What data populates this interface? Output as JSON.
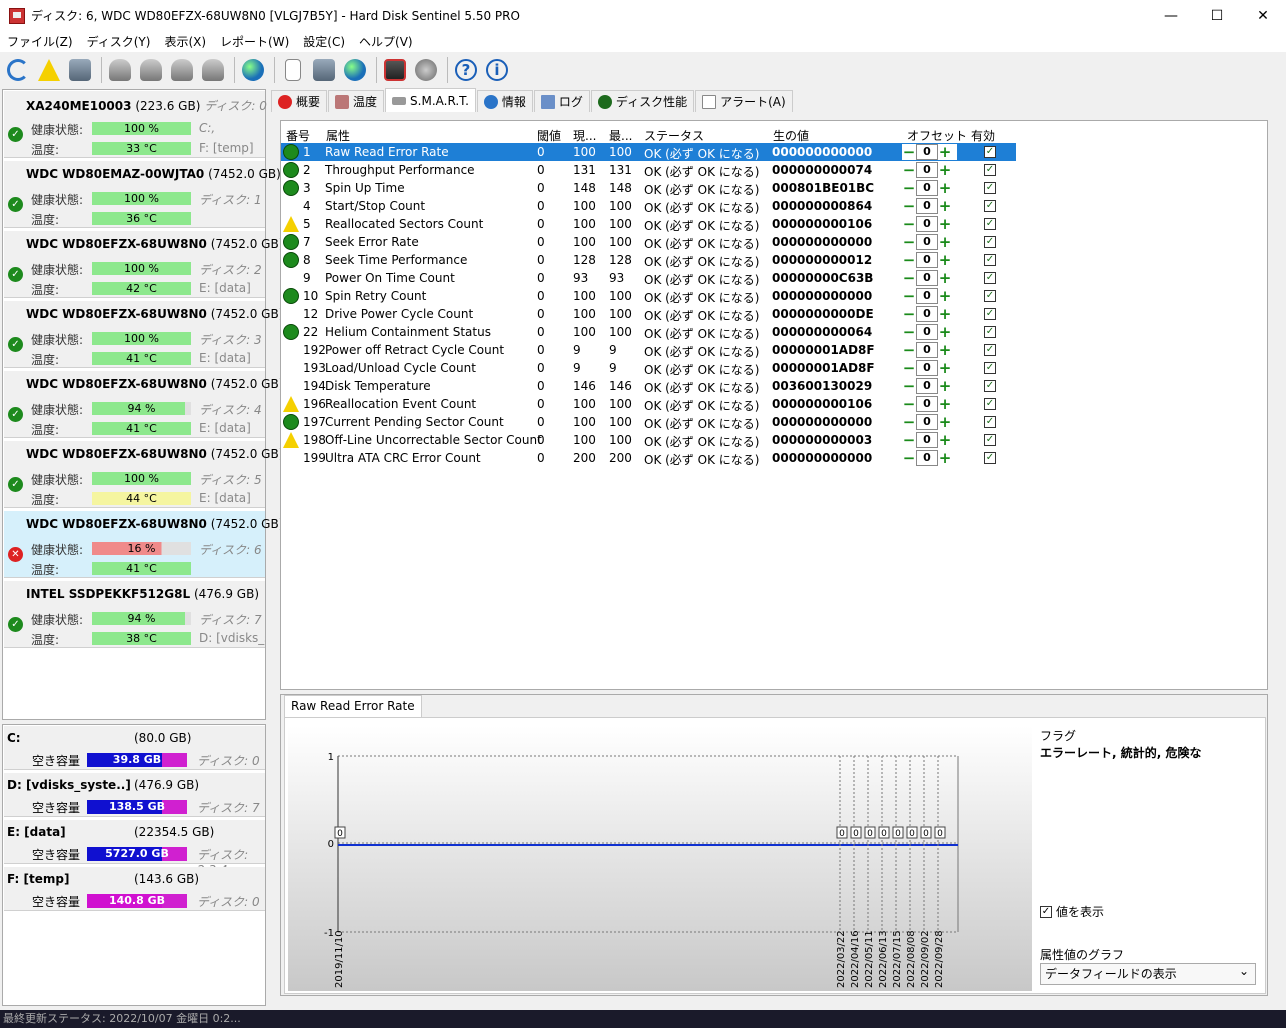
{
  "window": {
    "title": "ディスク: 6, WDC WD80EFZX-68UW8N0 [VLGJ7B5Y]  -  Hard Disk Sentinel 5.50 PRO",
    "min": "—",
    "max": "☐",
    "close": "✕"
  },
  "menu": [
    "ファイル(Z)",
    "ディスク(Y)",
    "表示(X)",
    "レポート(W)",
    "設定(C)",
    "ヘルプ(V)"
  ],
  "toolbar_icons": [
    "refresh-icon",
    "alert-icon",
    "disk-info-icon",
    "drive-icon",
    "drive-icon",
    "drive-icon",
    "drive-icon",
    "globe-icon",
    "document-icon",
    "sync-icon",
    "network-icon",
    "monitor-icon",
    "speaker-icon",
    "help-icon",
    "info-icon"
  ],
  "disks": [
    {
      "model": "XA240ME10003",
      "size": "(223.6 GB)",
      "disk": "ディスク: 0",
      "health": "100 %",
      "temp": "33 °C",
      "health_drv": "C:,",
      "temp_drv": "F: [temp]",
      "health_pct": 100,
      "status": "ok",
      "temp_color": "#8de88d"
    },
    {
      "model": "WDC WD80EMAZ-00WJTA0",
      "size": "(7452.0 GB)",
      "disk": "",
      "health": "100 %",
      "temp": "36 °C",
      "health_drv": "ディスク: 1",
      "temp_drv": "",
      "health_pct": 100,
      "status": "ok",
      "temp_color": "#8de88d"
    },
    {
      "model": "WDC WD80EFZX-68UW8N0",
      "size": "(7452.0 GB)",
      "disk": "",
      "health": "100 %",
      "temp": "42 °C",
      "health_drv": "ディスク: 2",
      "temp_drv": "E: [data]",
      "health_pct": 100,
      "status": "ok",
      "temp_color": "#8de88d"
    },
    {
      "model": "WDC WD80EFZX-68UW8N0",
      "size": "(7452.0 GB)",
      "disk": "",
      "health": "100 %",
      "temp": "41 °C",
      "health_drv": "ディスク: 3",
      "temp_drv": "E: [data]",
      "health_pct": 100,
      "status": "ok",
      "temp_color": "#8de88d"
    },
    {
      "model": "WDC WD80EFZX-68UW8N0",
      "size": "(7452.0 GB)",
      "disk": "",
      "health": "94 %",
      "temp": "41 °C",
      "health_drv": "ディスク: 4",
      "temp_drv": "E: [data]",
      "health_pct": 94,
      "status": "ok",
      "temp_color": "#8de88d"
    },
    {
      "model": "WDC WD80EFZX-68UW8N0",
      "size": "(7452.0 GB)",
      "disk": "",
      "health": "100 %",
      "temp": "44 °C",
      "health_drv": "ディスク: 5",
      "temp_drv": "E: [data]",
      "health_pct": 100,
      "status": "ok",
      "temp_color": "#f5f5a0"
    },
    {
      "model": "WDC WD80EFZX-68UW8N0",
      "size": "(7452.0 GB)",
      "disk": "",
      "health": "16 %",
      "temp": "41 °C",
      "health_drv": "ディスク: 6",
      "temp_drv": "",
      "health_pct": 16,
      "status": "bad",
      "temp_color": "#8de88d"
    },
    {
      "model": "INTEL SSDPEKKF512G8L",
      "size": "(476.9 GB)",
      "disk": "",
      "health": "94 %",
      "temp": "38 °C",
      "health_drv": "ディスク: 7",
      "temp_drv": "D: [vdisks_sy",
      "health_pct": 94,
      "status": "ok",
      "temp_color": "#8de88d"
    }
  ],
  "labels": {
    "health": "健康状態:",
    "temp": "温度:",
    "free": "空き容量"
  },
  "partitions": [
    {
      "name": "C:",
      "size": "(80.0 GB)",
      "free": "39.8 GB",
      "disk": "ディスク: 0",
      "color": "#1010d0"
    },
    {
      "name": "D: [vdisks_syste..]",
      "size": "(476.9 GB)",
      "free": "138.5 GB",
      "disk": "ディスク: 7",
      "color": "#1010d0"
    },
    {
      "name": "E: [data]",
      "size": "(22354.5 GB)",
      "free": "5727.0 GB",
      "disk": "ディスク: 2,3,4",
      "color": "#1010d0"
    },
    {
      "name": "F: [temp]",
      "size": "(143.6 GB)",
      "free": "140.8 GB",
      "disk": "ディスク: 0",
      "color": "#d010d0"
    }
  ],
  "tabs": [
    {
      "label": "概要",
      "icon": "error-icon"
    },
    {
      "label": "温度",
      "icon": "thermometer-icon"
    },
    {
      "label": "S.M.A.R.T.",
      "icon": "smart-icon"
    },
    {
      "label": "情報",
      "icon": "info-icon"
    },
    {
      "label": "ログ",
      "icon": "log-icon"
    },
    {
      "label": "ディスク性能",
      "icon": "performance-icon"
    },
    {
      "label": "アラート(A)",
      "icon": "alert-icon"
    }
  ],
  "smart": {
    "headers": {
      "id": "番号",
      "attr": "属性",
      "thr": "閾値",
      "cur": "現...",
      "worst": "最...",
      "status": "ステータス",
      "raw": "生の値",
      "offset": "オフセット",
      "enabled": "有効"
    },
    "rows": [
      {
        "id": "1",
        "attr": "Raw Read Error Rate",
        "thr": "0",
        "cur": "100",
        "worst": "100",
        "status": "OK (必ず OK になる)",
        "raw": "000000000000",
        "off": "0",
        "icon": "ok",
        "sel": true
      },
      {
        "id": "2",
        "attr": "Throughput Performance",
        "thr": "0",
        "cur": "131",
        "worst": "131",
        "status": "OK (必ず OK になる)",
        "raw": "000000000074",
        "off": "0",
        "icon": "ok"
      },
      {
        "id": "3",
        "attr": "Spin Up Time",
        "thr": "0",
        "cur": "148",
        "worst": "148",
        "status": "OK (必ず OK になる)",
        "raw": "000801BE01BC",
        "off": "0",
        "icon": "ok"
      },
      {
        "id": "4",
        "attr": "Start/Stop Count",
        "thr": "0",
        "cur": "100",
        "worst": "100",
        "status": "OK (必ず OK になる)",
        "raw": "000000000864",
        "off": "0",
        "icon": ""
      },
      {
        "id": "5",
        "attr": "Reallocated Sectors Count",
        "thr": "0",
        "cur": "100",
        "worst": "100",
        "status": "OK (必ず OK になる)",
        "raw": "000000000106",
        "off": "0",
        "icon": "warn"
      },
      {
        "id": "7",
        "attr": "Seek Error Rate",
        "thr": "0",
        "cur": "100",
        "worst": "100",
        "status": "OK (必ず OK になる)",
        "raw": "000000000000",
        "off": "0",
        "icon": "ok"
      },
      {
        "id": "8",
        "attr": "Seek Time Performance",
        "thr": "0",
        "cur": "128",
        "worst": "128",
        "status": "OK (必ず OK になる)",
        "raw": "000000000012",
        "off": "0",
        "icon": "ok"
      },
      {
        "id": "9",
        "attr": "Power On Time Count",
        "thr": "0",
        "cur": "93",
        "worst": "93",
        "status": "OK (必ず OK になる)",
        "raw": "00000000C63B",
        "off": "0",
        "icon": ""
      },
      {
        "id": "10",
        "attr": "Spin Retry Count",
        "thr": "0",
        "cur": "100",
        "worst": "100",
        "status": "OK (必ず OK になる)",
        "raw": "000000000000",
        "off": "0",
        "icon": "ok"
      },
      {
        "id": "12",
        "attr": "Drive Power Cycle Count",
        "thr": "0",
        "cur": "100",
        "worst": "100",
        "status": "OK (必ず OK になる)",
        "raw": "0000000000DE",
        "off": "0",
        "icon": ""
      },
      {
        "id": "22",
        "attr": "Helium Containment Status",
        "thr": "0",
        "cur": "100",
        "worst": "100",
        "status": "OK (必ず OK になる)",
        "raw": "000000000064",
        "off": "0",
        "icon": "ok"
      },
      {
        "id": "192",
        "attr": "Power off Retract Cycle Count",
        "thr": "0",
        "cur": "9",
        "worst": "9",
        "status": "OK (必ず OK になる)",
        "raw": "00000001AD8F",
        "off": "0",
        "icon": ""
      },
      {
        "id": "193",
        "attr": "Load/Unload Cycle Count",
        "thr": "0",
        "cur": "9",
        "worst": "9",
        "status": "OK (必ず OK になる)",
        "raw": "00000001AD8F",
        "off": "0",
        "icon": ""
      },
      {
        "id": "194",
        "attr": "Disk Temperature",
        "thr": "0",
        "cur": "146",
        "worst": "146",
        "status": "OK (必ず OK になる)",
        "raw": "003600130029",
        "off": "0",
        "icon": ""
      },
      {
        "id": "196",
        "attr": "Reallocation Event Count",
        "thr": "0",
        "cur": "100",
        "worst": "100",
        "status": "OK (必ず OK になる)",
        "raw": "000000000106",
        "off": "0",
        "icon": "warn"
      },
      {
        "id": "197",
        "attr": "Current Pending Sector Count",
        "thr": "0",
        "cur": "100",
        "worst": "100",
        "status": "OK (必ず OK になる)",
        "raw": "000000000000",
        "off": "0",
        "icon": "ok"
      },
      {
        "id": "198",
        "attr": "Off-Line Uncorrectable Sector Count",
        "thr": "0",
        "cur": "100",
        "worst": "100",
        "status": "OK (必ず OK になる)",
        "raw": "000000000003",
        "off": "0",
        "icon": "warn"
      },
      {
        "id": "199",
        "attr": "Ultra ATA CRC Error Count",
        "thr": "0",
        "cur": "200",
        "worst": "200",
        "status": "OK (必ず OK になる)",
        "raw": "000000000000",
        "off": "0",
        "icon": ""
      }
    ]
  },
  "graph": {
    "tab": "Raw Read Error Rate",
    "flags_label": "フラグ",
    "flags_value": "エラーレート, 統計的, 危険な",
    "show_values": "値を表示",
    "graph_label": "属性値のグラフ",
    "graph_select": "データフィールドの表示",
    "y_ticks": [
      "1",
      "0",
      "-1"
    ],
    "dates": [
      "2019/11/10",
      "2022/03/22",
      "2022/04/16",
      "2022/05/11",
      "2022/06/13",
      "2022/07/15",
      "2022/08/08",
      "2022/09/02",
      "2022/09/28"
    ]
  },
  "statusbar": "最終更新ステータス: 2022/10/07 金曜日 0:2..."
}
